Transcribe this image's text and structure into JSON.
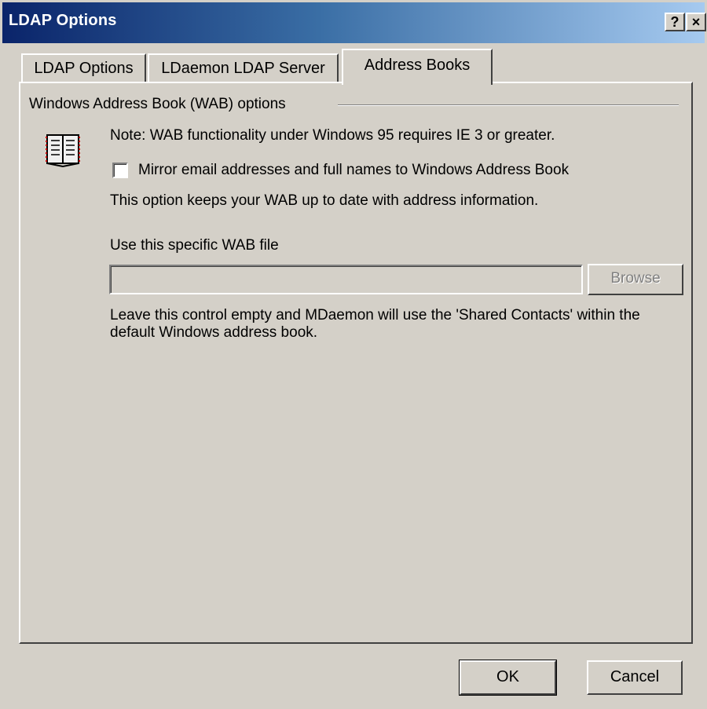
{
  "window": {
    "title": "LDAP Options",
    "help_label": "?",
    "close_label": "×"
  },
  "tabs": [
    {
      "label": "LDAP Options",
      "active": false
    },
    {
      "label": "LDaemon LDAP Server",
      "active": false
    },
    {
      "label": "Address Books",
      "active": true
    }
  ],
  "wab": {
    "group_title": "Windows Address Book (WAB) options",
    "icon": "address-book-icon",
    "note": "Note: WAB functionality under Windows 95 requires IE 3 or greater.",
    "mirror_checkbox": {
      "label": "Mirror email addresses and full names to Windows Address Book",
      "checked": false
    },
    "mirror_description": "This option keeps your WAB up to date with address information.",
    "file_label": "Use this specific WAB file",
    "file_value": "",
    "browse_label": "Browse",
    "empty_note": "Leave this control empty and MDaemon will use the 'Shared Contacts' within the default Windows address book."
  },
  "buttons": {
    "ok": "OK",
    "cancel": "Cancel"
  }
}
